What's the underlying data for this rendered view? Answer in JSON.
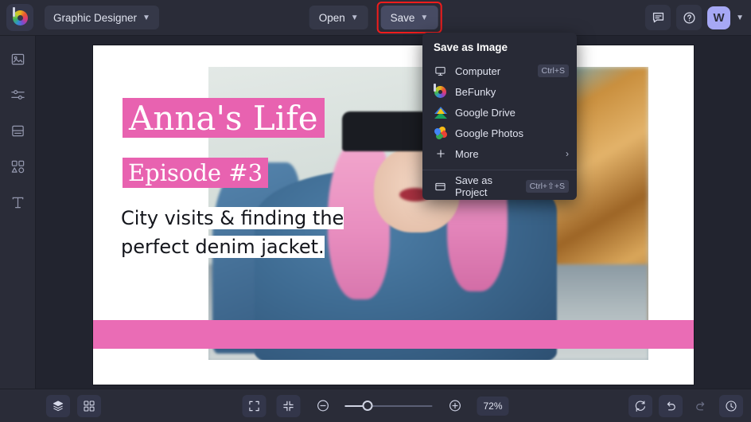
{
  "app": {
    "logo": "befunky-logo",
    "project_name": "Graphic Designer"
  },
  "topbar": {
    "open_label": "Open",
    "save_label": "Save",
    "chat_icon": "chat-icon",
    "help_icon": "help-icon",
    "avatar_initial": "W",
    "save_highlight_color": "#f01c1c"
  },
  "sidebar": {
    "items": [
      {
        "name": "image-manager",
        "icon": "image-icon"
      },
      {
        "name": "edit-adjust",
        "icon": "sliders-icon"
      },
      {
        "name": "templates",
        "icon": "template-icon"
      },
      {
        "name": "graphics",
        "icon": "shapes-icon"
      },
      {
        "name": "text",
        "icon": "text-icon"
      }
    ]
  },
  "save_menu": {
    "title": "Save as Image",
    "items": [
      {
        "label": "Computer",
        "icon": "monitor-icon",
        "shortcut": "Ctrl+S"
      },
      {
        "label": "BeFunky",
        "icon": "befunky-icon",
        "shortcut": ""
      },
      {
        "label": "Google Drive",
        "icon": "google-drive-icon",
        "shortcut": ""
      },
      {
        "label": "Google Photos",
        "icon": "google-photos-icon",
        "shortcut": ""
      },
      {
        "label": "More",
        "icon": "plus-icon",
        "shortcut": "",
        "submenu": true
      }
    ],
    "project_item": {
      "label": "Save as Project",
      "icon": "folder-icon",
      "shortcut": "Ctrl+⇧+S"
    }
  },
  "canvas": {
    "title": "Anna's Life",
    "subtitle": "Episode #3",
    "body": "City visits & finding the\nperfect denim jacket.",
    "accent_color": "#e862b0",
    "background_color": "#ffffff",
    "photo_alt": "woman-with-pink-hair-denim-jacket"
  },
  "bottombar": {
    "layers_icon": "layers-icon",
    "grid_icon": "grid-icon",
    "fit_screen_icon": "fit-screen-icon",
    "collapse_icon": "collapse-icon",
    "zoom_out_icon": "zoom-out-icon",
    "zoom_in_icon": "zoom-in-icon",
    "zoom_level": "72%",
    "reset_icon": "reset-icon",
    "undo_icon": "undo-icon",
    "redo_icon": "redo-icon",
    "history_icon": "history-icon"
  }
}
